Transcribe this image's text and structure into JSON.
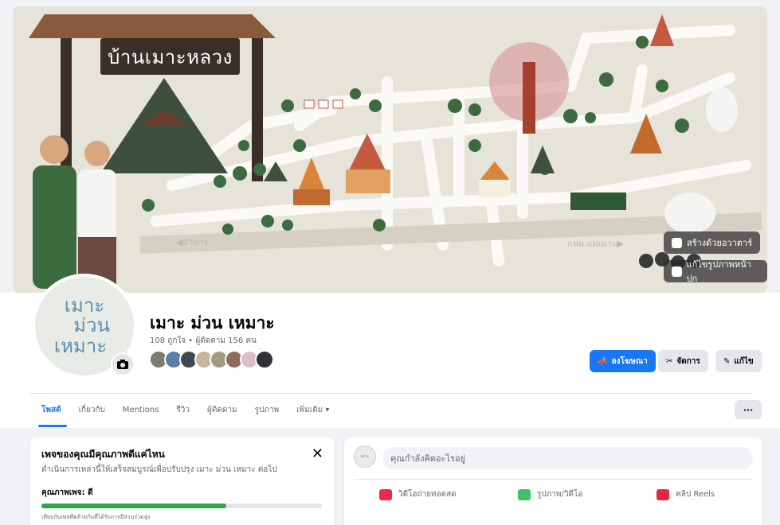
{
  "cover": {
    "sign_text": "บ้านเมาะหลวง",
    "road_left": "◀ลำปาง",
    "road_right": "กฟผ.แม่เมาะ▶",
    "btn_avatar": "สร้างด้วยอวาตาร์",
    "btn_edit_cover": "แก้ไขรูปภาพหน้าปก"
  },
  "profile": {
    "avatar_lines": [
      "เมาะ",
      "ม่วน",
      "เหมาะ"
    ],
    "page_name": "เมาะ ม่วน เหมาะ",
    "stats": "108 ถูกใจ • ผู้ติดตาม 156 คน"
  },
  "actions": {
    "promote": "ลงโฆษณา",
    "manage": "จัดการ",
    "edit": "แก้ไข"
  },
  "tabs": [
    "โพสต์",
    "เกี่ยวกับ",
    "Mentions",
    "รีวิว",
    "ผู้ติดตาม",
    "รูปภาพ",
    "เพิ่มเติม ▾"
  ],
  "more_button": "···",
  "quality_card": {
    "title": "เพจของคุณมีคุณภาพดีแค่ไหน",
    "desc": "ดำเนินการเหล่านี้ให้เสร็จสมบูรณ์เพื่อปรับปรุง เมาะ ม่วน เหมาะ ต่อไป",
    "label": "คุณภาพเพจ: ดี",
    "progress": 0.66,
    "note": "เทียบกับเพจที่คล้ายกันที่ได้รับการมีส่วนร่วมสูง",
    "close": "✕"
  },
  "composer": {
    "placeholder": "คุณกำลังคิดอะไรอยู่",
    "live": "วิดีโอถ่ายทอดสด",
    "photo": "รูปภาพ/วิดีโอ",
    "reels": "คลิป Reels"
  },
  "colors": {
    "brand": "#1877f2",
    "progress": "#31a24c",
    "live": "#f02849",
    "photo": "#45bd62",
    "reels": "#e42645"
  }
}
